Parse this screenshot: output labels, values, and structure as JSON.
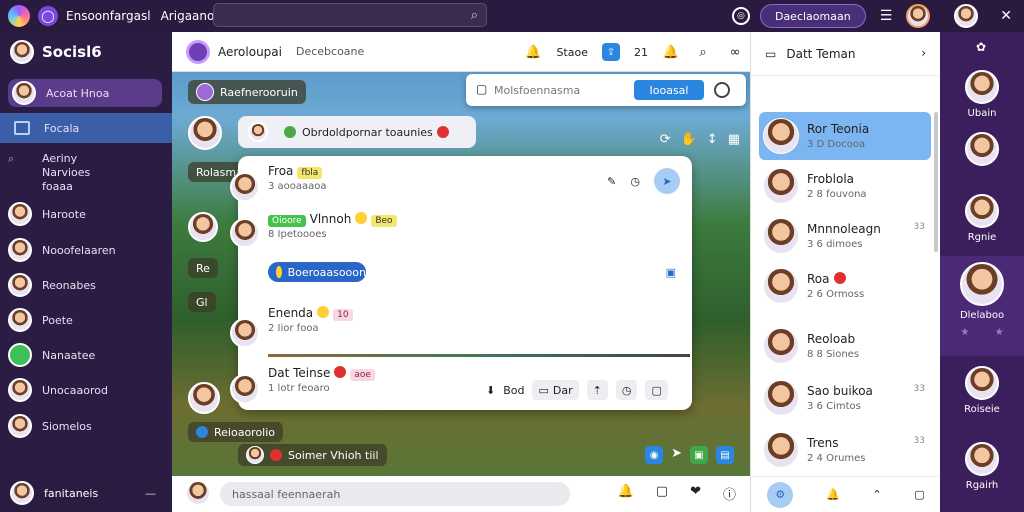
{
  "topbar": {
    "title": "Ensoonfargasl",
    "title2": "Arigaano",
    "pill_label": "Daeclaomaan"
  },
  "sidebar": {
    "header": "Socisl6",
    "items": [
      {
        "label": "Acoat Hnoa"
      },
      {
        "label": "Focala"
      },
      {
        "label": "Aeriny\nNarvioes\nfoaaa"
      },
      {
        "label": "Haroote"
      },
      {
        "label": "Nooofelaaren"
      },
      {
        "label": "Reonabes"
      },
      {
        "label": "Poete"
      },
      {
        "label": "Nanaatee"
      },
      {
        "label": "Unocaaorod"
      },
      {
        "label": "Siomelos"
      }
    ],
    "footer_label": "fanitaneis"
  },
  "main": {
    "header_name": "Aeroloupai",
    "header_sub": "Decebcoane",
    "header_tool_label": "Staoe",
    "header_tool_count": "21",
    "chip_top": "Raefnerooruin",
    "bubble_top": "Obrdoldpornar toaunies",
    "search_placeholder": "Molsfoennasma",
    "search_button": "Iooasal",
    "chip_left1": "Rolasmaa",
    "chip_left2": "Re",
    "chip_left3": "Gl",
    "chip_bottom1": "Reioaorolio",
    "chip_bottom2": "Soimer Vhioh tiil",
    "input_placeholder": "hassaal feennaerah"
  },
  "chat": {
    "m1": {
      "name": "Froa",
      "tag": "fbla",
      "time": "3 aooaaaoa"
    },
    "m2": {
      "name": "Vlnnoh",
      "tag_pre": "Oioore",
      "tag": "Beo",
      "time": "8 Ipetoooes"
    },
    "pill": "Boeroaasooon",
    "m3": {
      "name": "Enenda",
      "tag": "10",
      "time": "2 Iior fooa"
    },
    "m4": {
      "name": "Dat Teinse",
      "tag": "aoe",
      "time": "1 lotr feoaro"
    },
    "reply1": "Bod",
    "reply2": "Dar"
  },
  "rpanel": {
    "title": "Datt Teman",
    "contacts": [
      {
        "name": "Ror Teonia",
        "time": "3 D Docooa",
        "trail": ""
      },
      {
        "name": "Froblola",
        "time": "2 8 fouvona",
        "trail": ""
      },
      {
        "name": "Mnnnoleagn",
        "time": "3 6 dimoes",
        "trail": "33"
      },
      {
        "name": "Roa",
        "time": "2 6 Ormoss",
        "trail": ""
      },
      {
        "name": "Reoloab",
        "time": "8 8 Siones",
        "trail": ""
      },
      {
        "name": "Sao buikoa",
        "time": "3 6 Cimtos",
        "trail": "33"
      },
      {
        "name": "Trens",
        "time": "2 4 Orumes",
        "trail": "33"
      }
    ]
  },
  "stories": [
    {
      "label": "Ubain"
    },
    {
      "label": ""
    },
    {
      "label": "Rgnie"
    },
    {
      "label": "Dlelaboo"
    },
    {
      "label": "Roiseie"
    },
    {
      "label": "Rgairh"
    }
  ],
  "colors": {
    "accent": "#7b4ad8",
    "blue": "#2a86e0",
    "sidebar": "#2b1c44"
  }
}
